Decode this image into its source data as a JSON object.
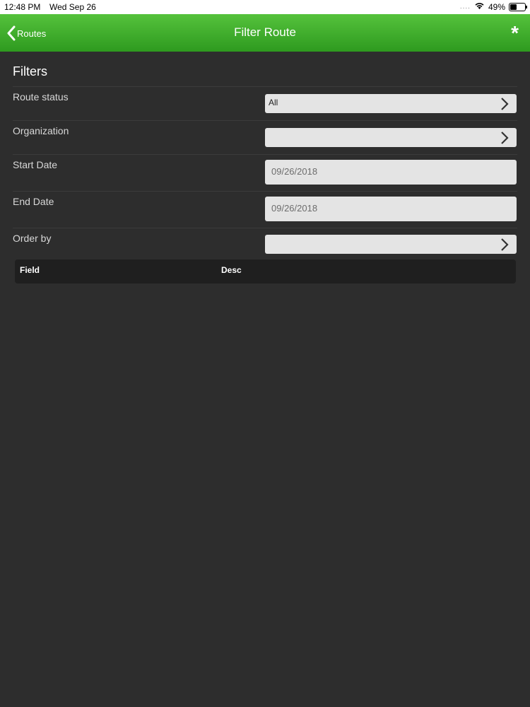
{
  "status_bar": {
    "time": "12:48 PM",
    "date": "Wed Sep 26",
    "signal": "....",
    "battery": "49%",
    "battery_level": 0.49
  },
  "nav": {
    "back_label": "Routes",
    "title": "Filter Route",
    "action": "*",
    "bar_color": "#3aaa2a"
  },
  "filters": {
    "title": "Filters",
    "route_status": {
      "label": "Route status",
      "value": "All"
    },
    "organization": {
      "label": "Organization",
      "value": ""
    },
    "start_date": {
      "label": "Start Date",
      "value": "09/26/2018"
    },
    "end_date": {
      "label": "End Date",
      "value": "09/26/2018"
    },
    "order_by": {
      "label": "Order by",
      "value": ""
    }
  },
  "order_table": {
    "columns": [
      "Field",
      "Desc"
    ]
  }
}
